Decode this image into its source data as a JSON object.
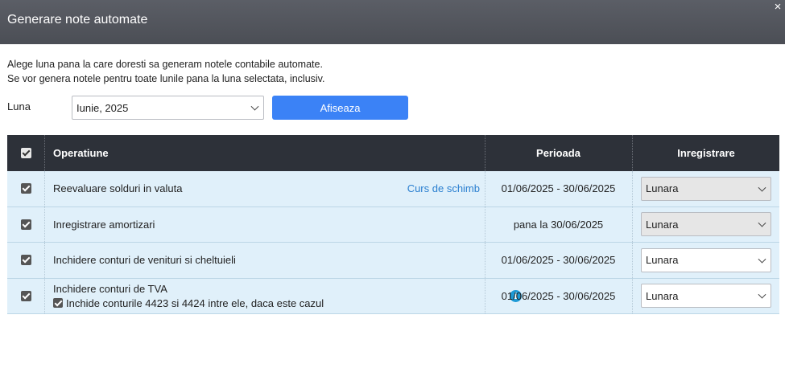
{
  "dialog": {
    "title": "Generare note automate",
    "close_glyph": "×"
  },
  "intro": {
    "line1": "Alege luna pana la care doresti sa generam notele contabile automate.",
    "line2": "Se vor genera notele pentru toate lunile pana la luna selectata, inclusiv."
  },
  "luna": {
    "label": "Luna",
    "selected": "Iunie, 2025"
  },
  "afiseaza_label": "Afiseaza",
  "table": {
    "headers": {
      "operatiune": "Operatiune",
      "perioada": "Perioada",
      "inregistrare": "Inregistrare"
    },
    "rows": [
      {
        "operatiune": "Reevaluare solduri in valuta",
        "link": "Curs de schimb",
        "perioada": "01/06/2025 - 30/06/2025",
        "inregistrare": "Lunara",
        "disabled": true
      },
      {
        "operatiune": "Inregistrare amortizari",
        "perioada": "pana la 30/06/2025",
        "inregistrare": "Lunara",
        "disabled": true
      },
      {
        "operatiune": "Inchidere conturi de venituri si cheltuieli",
        "perioada": "01/06/2025 - 30/06/2025",
        "inregistrare": "Lunara",
        "disabled": false
      },
      {
        "operatiune": "Inchidere conturi de TVA",
        "sub_option": "Inchide conturile 4423 si 4424 intre ele, daca este cazul",
        "info_glyph": "i",
        "perioada": "01/06/2025 - 30/06/2025",
        "inregistrare": "Lunara",
        "disabled": false
      }
    ]
  },
  "colors": {
    "header_bar": "#4b4e55",
    "table_header": "#2d3139",
    "row_bg": "#e0f0fa",
    "accent": "#3b82f6",
    "link": "#2a7fd0",
    "info": "#1e9ad6"
  },
  "icons": {
    "close": "close-icon",
    "chevron": "chevron-down-icon",
    "info": "info-icon",
    "checkbox": "checkbox-checked-icon"
  }
}
